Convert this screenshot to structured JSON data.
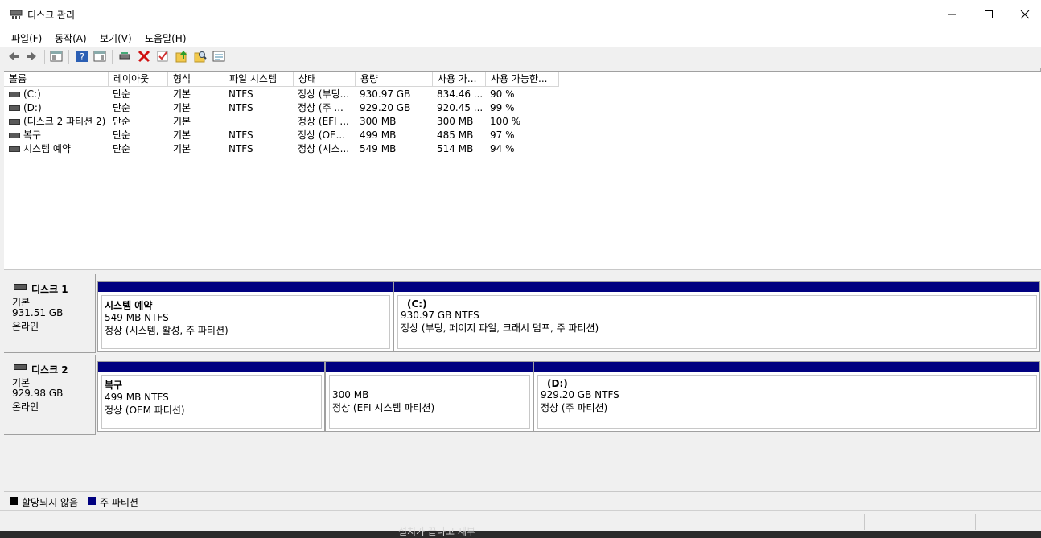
{
  "window": {
    "title": "디스크 관리",
    "minimize_label": "—",
    "maximize_label": "☐",
    "close_label": "✕"
  },
  "menu": [
    "파일(F)",
    "동작(A)",
    "보기(V)",
    "도움말(H)"
  ],
  "toolbar_icons": [
    "back-icon",
    "forward-icon",
    "console-tree-icon",
    "help-icon",
    "properties-icon",
    "connect-icon",
    "delete-icon",
    "check-icon",
    "up-icon",
    "search-icon",
    "view-icon"
  ],
  "volume_table": {
    "columns": [
      "볼륨",
      "레이아웃",
      "형식",
      "파일 시스템",
      "상태",
      "용량",
      "사용 가...",
      "사용 가능한..."
    ],
    "rows": [
      [
        "(C:)",
        "단순",
        "기본",
        "NTFS",
        "정상 (부팅...",
        "930.97 GB",
        "834.46 ...",
        "90 %"
      ],
      [
        "(D:)",
        "단순",
        "기본",
        "NTFS",
        "정상 (주 ...",
        "929.20 GB",
        "920.45 ...",
        "99 %"
      ],
      [
        "(디스크 2 파티션 2)",
        "단순",
        "기본",
        "",
        "정상 (EFI ...",
        "300 MB",
        "300 MB",
        "100 %"
      ],
      [
        "복구",
        "단순",
        "기본",
        "NTFS",
        "정상 (OE...",
        "499 MB",
        "485 MB",
        "97 %"
      ],
      [
        "시스템 예약",
        "단순",
        "기본",
        "NTFS",
        "정상 (시스...",
        "549 MB",
        "514 MB",
        "94 %"
      ]
    ]
  },
  "disks": [
    {
      "name": "디스크 1",
      "type": "기본",
      "size": "931.51 GB",
      "state": "온라인",
      "partitions": [
        {
          "name": "시스템 예약",
          "size": "549 MB NTFS",
          "status": "정상 (시스템, 활성, 주 파티션)"
        },
        {
          "name": "(C:)",
          "size": "930.97 GB NTFS",
          "status": "정상 (부팅, 페이지 파일, 크래시 덤프, 주 파티션)"
        }
      ]
    },
    {
      "name": "디스크 2",
      "type": "기본",
      "size": "929.98 GB",
      "state": "온라인",
      "partitions": [
        {
          "name": "복구",
          "size": "499 MB NTFS",
          "status": "정상 (OEM 파티션)"
        },
        {
          "name": "",
          "size": "300 MB",
          "status": "정상 (EFI 시스템 파티션)"
        },
        {
          "name": "(D:)",
          "size": "929.20 GB NTFS",
          "status": "정상 (주 파티션)"
        }
      ]
    }
  ],
  "legend": [
    {
      "label": "할당되지 않음",
      "color": "#000000"
    },
    {
      "label": "주 파티션",
      "color": "#000080"
    }
  ],
  "taskbar_text": "설치가 끝나고 재부"
}
